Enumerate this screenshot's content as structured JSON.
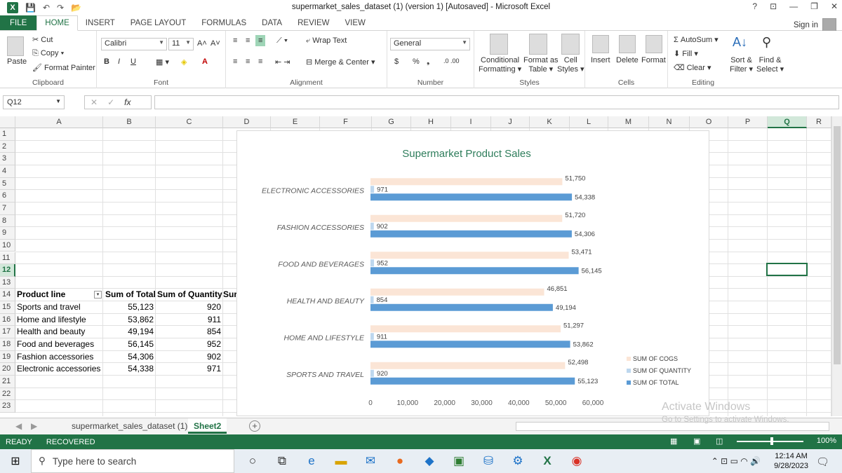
{
  "window": {
    "title": "supermarket_sales_dataset (1) (version 1) [Autosaved] - Microsoft Excel",
    "help": "?",
    "controls": [
      "⊡",
      "—",
      "❐",
      "✕"
    ]
  },
  "ribbon_tabs": [
    "FILE",
    "HOME",
    "INSERT",
    "PAGE LAYOUT",
    "FORMULAS",
    "DATA",
    "REVIEW",
    "VIEW"
  ],
  "active_tab": "HOME",
  "sign_in": "Sign in",
  "ribbon": {
    "clipboard": {
      "paste": "Paste",
      "cut": "Cut",
      "copy": "Copy",
      "format_painter": "Format Painter",
      "label": "Clipboard"
    },
    "font": {
      "name": "Calibri",
      "size": "11",
      "bold": "B",
      "italic": "I",
      "underline": "U",
      "grow": "A˄",
      "shrink": "A˅",
      "label": "Font"
    },
    "alignment": {
      "wrap": "Wrap Text",
      "merge": "Merge & Center",
      "label": "Alignment"
    },
    "number": {
      "format": "General",
      "currency": "$",
      "percent": "%",
      "comma": "❟",
      "label": "Number"
    },
    "styles": {
      "conditional": [
        "Conditional",
        "Formatting"
      ],
      "format_as": [
        "Format as",
        "Table"
      ],
      "cell_styles": [
        "Cell",
        "Styles"
      ],
      "label": "Styles"
    },
    "cells": {
      "insert": "Insert",
      "delete": "Delete",
      "format": "Format",
      "label": "Cells"
    },
    "editing": {
      "autosum": "AutoSum",
      "fill": "Fill",
      "clear": "Clear",
      "sort": [
        "Sort &",
        "Filter"
      ],
      "find": [
        "Find &",
        "Select"
      ],
      "label": "Editing"
    }
  },
  "formula_bar": {
    "name_box": "Q12",
    "fx": "fx",
    "formula": ""
  },
  "columns": [
    "A",
    "B",
    "C",
    "D",
    "E",
    "F",
    "G",
    "H",
    "I",
    "J",
    "K",
    "L",
    "M",
    "N",
    "O",
    "P",
    "Q",
    "R"
  ],
  "selected_column": "Q",
  "rows": [
    "1",
    "2",
    "3",
    "4",
    "5",
    "6",
    "7",
    "8",
    "9",
    "10",
    "11",
    "12",
    "13",
    "14",
    "15",
    "16",
    "17",
    "18",
    "19",
    "20",
    "21",
    "22",
    "23"
  ],
  "selected_row": "12",
  "pivot": {
    "headers": [
      "Product line",
      "Sum of Total",
      "Sum of Quantity",
      "Sur"
    ],
    "rows": [
      [
        "Sports and travel",
        "55,123",
        "920"
      ],
      [
        "Home and lifestyle",
        "53,862",
        "911"
      ],
      [
        "Health and beauty",
        "49,194",
        "854"
      ],
      [
        "Food and beverages",
        "56,145",
        "952"
      ],
      [
        "Fashion accessories",
        "54,306",
        "902"
      ],
      [
        "Electronic accessories",
        "54,338",
        "971"
      ]
    ]
  },
  "chart_data": {
    "type": "bar",
    "orientation": "horizontal",
    "title": "Supermarket Product Sales",
    "categories": [
      "Electronic accessories",
      "Fashion accessories",
      "Food and beverages",
      "Health and beauty",
      "Home and lifestyle",
      "Sports and travel"
    ],
    "series": [
      {
        "name": "Sum of COGS",
        "color": "#fbe5d6",
        "values": [
          51750,
          51720,
          53471,
          46851,
          51297,
          52498
        ],
        "labels": [
          "51,750",
          "51,720",
          "53,471",
          "46,851",
          "51,297",
          "52,498"
        ]
      },
      {
        "name": "Sum of Quantity",
        "color": "#bdd7ee",
        "values": [
          971,
          902,
          952,
          854,
          911,
          920
        ],
        "labels": [
          "971",
          "902",
          "952",
          "854",
          "911",
          "920"
        ]
      },
      {
        "name": "Sum of Total",
        "color": "#5b9bd5",
        "values": [
          54338,
          54306,
          56145,
          49194,
          53862,
          55123
        ],
        "labels": [
          "54,338",
          "54,306",
          "56,145",
          "49,194",
          "53,862",
          "55,123"
        ]
      }
    ],
    "xticks": [
      "0",
      "10,000",
      "20,000",
      "30,000",
      "40,000",
      "50,000",
      "60,000"
    ],
    "xlim": [
      0,
      60000
    ],
    "grid": false,
    "legend_position": "bottom-right",
    "category_labels": [
      "ELECTRONIC ACCESSORIES",
      "FASHION ACCESSORIES",
      "FOOD AND BEVERAGES",
      "HEALTH AND BEAUTY",
      "HOME AND LIFESTYLE",
      "SPORTS AND TRAVEL"
    ],
    "legend_labels": [
      "SUM OF COGS",
      "SUM OF QUANTITY",
      "SUM OF TOTAL"
    ]
  },
  "sheets": [
    "supermarket_sales_dataset (1)",
    "Sheet2"
  ],
  "active_sheet": "Sheet2",
  "watermark": {
    "title": "Activate Windows",
    "subtitle": "Go to Settings to activate Windows."
  },
  "status": {
    "ready": "READY",
    "recovered": "RECOVERED",
    "zoom": "100%"
  },
  "taskbar": {
    "search_placeholder": "Type here to search",
    "time": "12:14 AM",
    "date": "9/28/2023"
  },
  "colors": {
    "excel_green": "#217346",
    "accent_blue": "#5b9bd5"
  }
}
